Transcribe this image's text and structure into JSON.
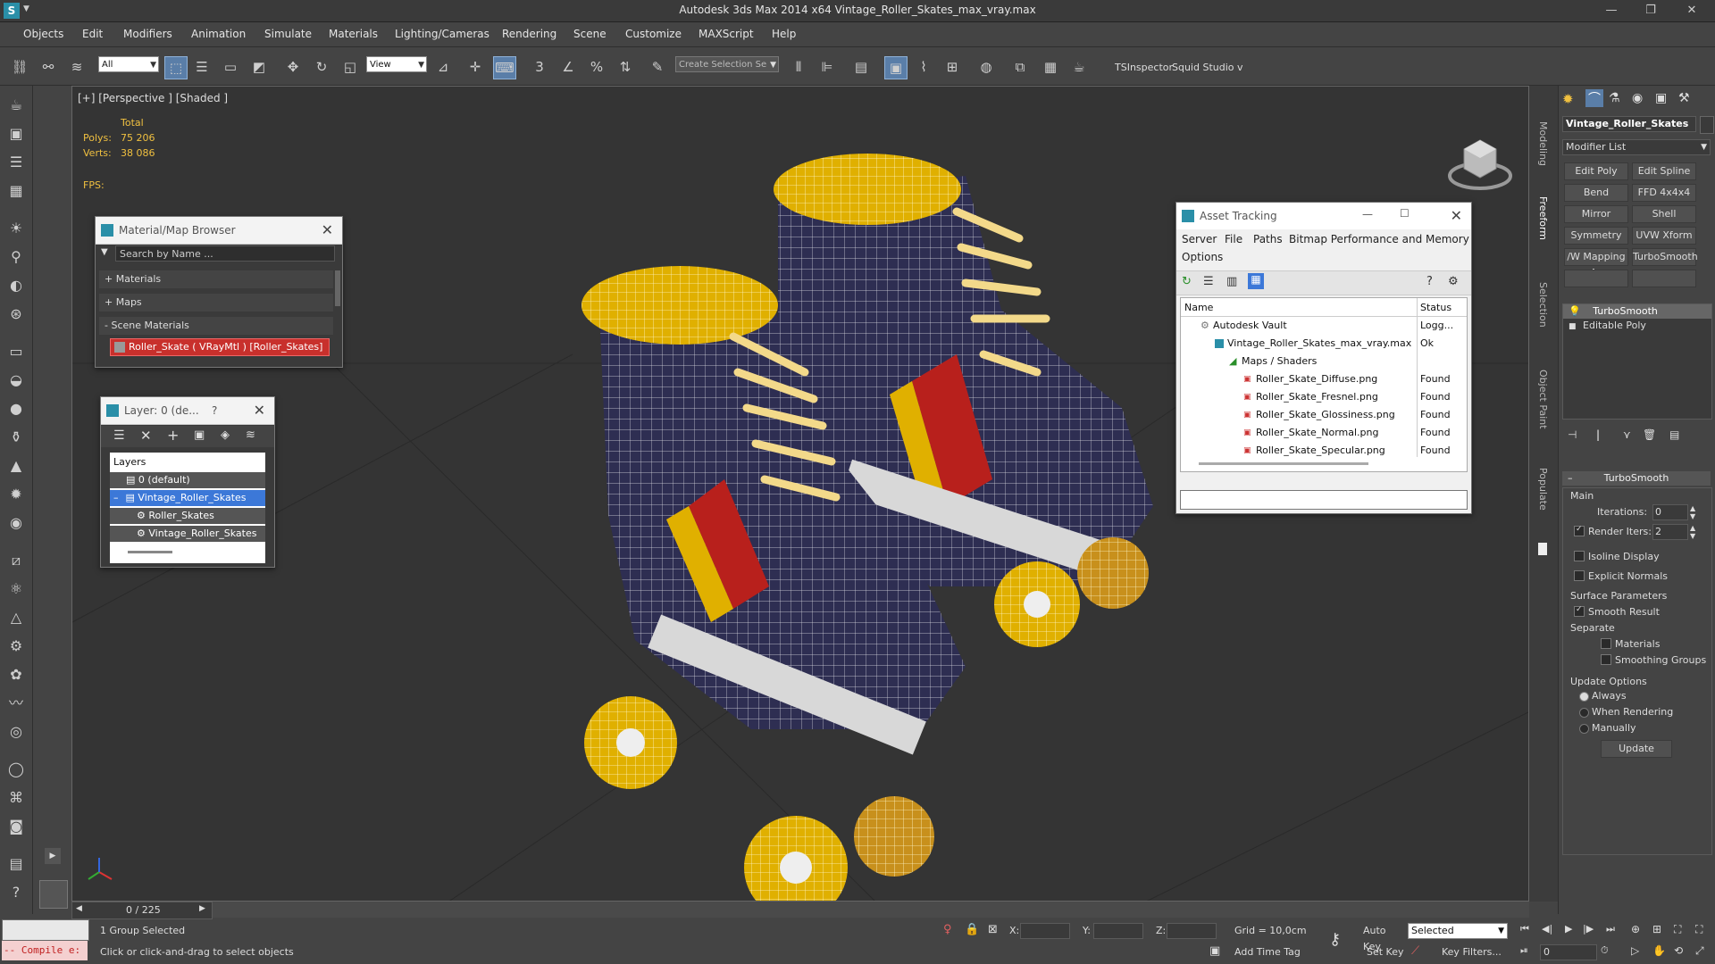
{
  "app": {
    "title": "Autodesk 3ds Max  2014 x64    Vintage_Roller_Skates_max_vray.max",
    "window_controls": [
      "—",
      "❐",
      "✕"
    ]
  },
  "menu": [
    "Objects",
    "Edit",
    "Modifiers",
    "Animation",
    "Simulate",
    "Materials",
    "Lighting/Cameras",
    "Rendering",
    "Scene",
    "Customize",
    "MAXScript",
    "Help"
  ],
  "toolbar": {
    "filter_value": "All",
    "view_value": "View",
    "selection_set_placeholder": "Create Selection Se",
    "ts_inspector": "TSInspector",
    "squid_studio": "Squid Studio v"
  },
  "viewport": {
    "label": "[+] [Perspective ] [Shaded ]",
    "stats": {
      "total_label": "Total",
      "polys_label": "Polys:",
      "polys_value": "75 206",
      "verts_label": "Verts:",
      "verts_value": "38 086",
      "fps_label": "FPS:"
    }
  },
  "material_browser": {
    "title": "Material/Map Browser",
    "search_placeholder": "Search by Name ...",
    "sections": [
      "+ Materials",
      "+ Maps",
      "- Scene Materials"
    ],
    "item": "Roller_Skate  ( VRayMtl ) [Roller_Skates]"
  },
  "layer_dialog": {
    "title": "Layer: 0 (de...",
    "help": "?",
    "header": "Layers",
    "rows": [
      {
        "label": "0 (default)"
      },
      {
        "label": "Vintage_Roller_Skates"
      },
      {
        "label": "Roller_Skates"
      },
      {
        "label": "Vintage_Roller_Skates"
      }
    ]
  },
  "asset_tracking": {
    "title": "Asset Tracking",
    "menu": [
      "Server",
      "File",
      "Paths",
      "Bitmap Performance and Memory",
      "Options"
    ],
    "columns": [
      "Name",
      "Status"
    ],
    "rows": [
      {
        "name": "Autodesk Vault",
        "status": "Logg..."
      },
      {
        "name": "Vintage_Roller_Skates_max_vray.max",
        "status": "Ok"
      },
      {
        "name": "Maps / Shaders",
        "status": ""
      },
      {
        "name": "Roller_Skate_Diffuse.png",
        "status": "Found"
      },
      {
        "name": "Roller_Skate_Fresnel.png",
        "status": "Found"
      },
      {
        "name": "Roller_Skate_Glossiness.png",
        "status": "Found"
      },
      {
        "name": "Roller_Skate_Normal.png",
        "status": "Found"
      },
      {
        "name": "Roller_Skate_Specular.png",
        "status": "Found"
      }
    ]
  },
  "side_tabs": [
    "Modeling",
    "Freeform",
    "Selection",
    "Object Paint",
    "Populate"
  ],
  "command_panel": {
    "object_name": "Vintage_Roller_Skates",
    "modifier_list": "Modifier List",
    "mod_buttons": [
      "Edit Poly",
      "Edit Spline",
      "Bend",
      "FFD 4x4x4",
      "Mirror",
      "Shell",
      "Symmetry",
      "UVW Xform",
      "/W Mapping Ac",
      "TurboSmooth"
    ],
    "stack": [
      "TurboSmooth",
      "Editable Poly"
    ],
    "rollout_title": "TurboSmooth",
    "main_label": "Main",
    "iterations_label": "Iterations:",
    "iterations_value": "0",
    "render_iters_label": "Render Iters:",
    "render_iters_value": "2",
    "isoline": "Isoline Display",
    "explicit_normals": "Explicit Normals",
    "surface_params": "Surface Parameters",
    "smooth_result": "Smooth Result",
    "separate": "Separate",
    "materials": "Materials",
    "smoothing_groups": "Smoothing Groups",
    "update_options": "Update Options",
    "always": "Always",
    "when_rendering": "When Rendering",
    "manually": "Manually",
    "update_button": "Update"
  },
  "timeline": {
    "counter": "0 / 225"
  },
  "status": {
    "maxscript": "-- Compile e:",
    "selected_text": "1 Group Selected",
    "prompt": "Click or click-and-drag to select objects",
    "x_label": "X:",
    "y_label": "Y:",
    "z_label": "Z:",
    "grid": "Grid = 10,0cm",
    "add_time_tag": "Add Time Tag",
    "auto_key": "Auto Key",
    "selected_combo": "Selected",
    "set_key": "Set Key",
    "key_filters": "Key Filters...",
    "frame_value": "0"
  },
  "colors": {
    "ui_dark": "#444444",
    "viewport_bg": "#343434",
    "highlight": "#3c78d8",
    "wire_yellow": "#e0b000",
    "skate_navy": "#2e2e52",
    "stripe_red": "#b8201c"
  }
}
